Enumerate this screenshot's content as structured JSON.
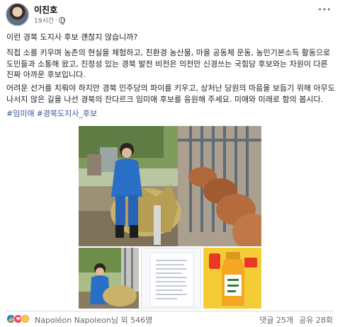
{
  "post": {
    "author": "이진호",
    "time": "19시간",
    "more_label": "···",
    "paragraphs": [
      "이런 경북 도지사 후보 괜찮지 않습니까?",
      "직접 소를 키우며 농촌의 현실을 체험하고, 친환경 농산물, 마을 공동체 운동, 농민기본소득 활동으로 도민들과 소통해 왔고, 진정성 있는 경북 발전 비전은 의전만 신경쓰는 국힘당 후보와는 차원이 다른 진짜 아까운 후보입니다.",
      "어려운 선거를 치뤄야 하지만 경북 민주당의 파이를 키우고, 상처난 당원의 마음을 보듬기 위해 아무도 나서지 않은 길을 나선 경북의 잔다르크 임미애 후보를 응원해 주세요. 미애와 미래로 함의 봅시다."
    ],
    "hashtags": [
      "#임미애",
      "#경북도지사_후보"
    ]
  },
  "images": {
    "main": "photo-woman-feeding-hay-to-cattle",
    "thumb1": "photo-woman-carrying-hay",
    "thumb2": "document-page",
    "thumb3": "poster-drink-bottle"
  },
  "footer": {
    "reactions_text": "Napoléon Napoleon님 외 546명",
    "comments": "댓글 25개",
    "shares": "공유 28회"
  },
  "colors": {
    "link": "#385898",
    "like": "#1877f2",
    "love": "#f33e58",
    "care": "#f7b125"
  }
}
